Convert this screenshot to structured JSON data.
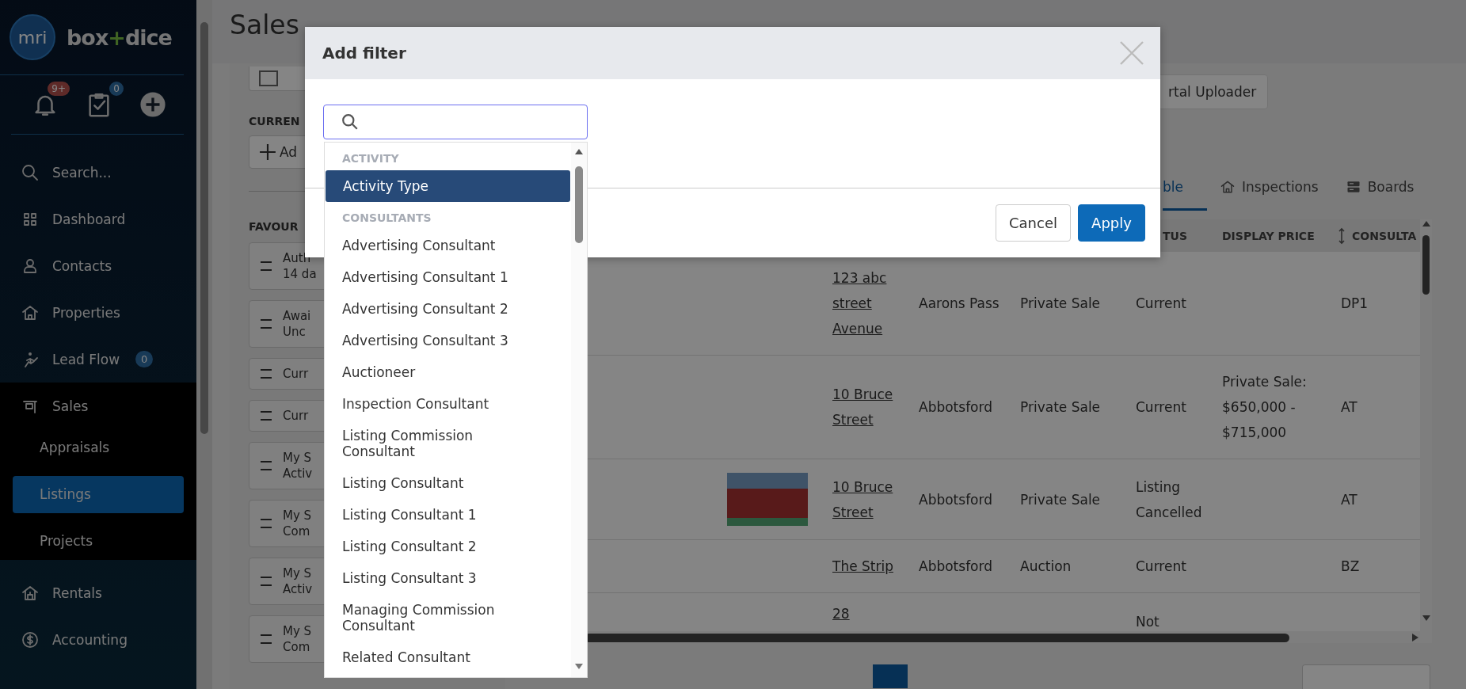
{
  "sidebar": {
    "logo_mark": "mri",
    "wordmark": [
      "box",
      "+",
      "dice"
    ],
    "quick_actions": [
      {
        "kind": "notifications",
        "badge": "9+"
      },
      {
        "kind": "tasks",
        "badge": "0"
      },
      {
        "kind": "create"
      }
    ],
    "nav": [
      {
        "label": "Search..."
      },
      {
        "label": "Dashboard"
      },
      {
        "label": "Contacts"
      },
      {
        "label": "Properties"
      },
      {
        "label": "Lead Flow",
        "badge": "0"
      },
      {
        "label": "Sales",
        "expanded": true,
        "children": [
          {
            "label": "Appraisals",
            "selected": false
          },
          {
            "label": "Listings",
            "selected": true
          },
          {
            "label": "Projects",
            "selected": false
          }
        ]
      },
      {
        "label": "Rentals"
      },
      {
        "label": "Accounting"
      }
    ]
  },
  "page": {
    "title": "Sales"
  },
  "left_panel": {
    "current_label": "CURREN",
    "add_button": "Ad",
    "favourites_label": "FAVOUR",
    "favourites": [
      {
        "lines": [
          "Auth",
          "14 da"
        ]
      },
      {
        "lines": [
          "Awai",
          "Unc"
        ]
      },
      {
        "lines": [
          "Curr"
        ]
      },
      {
        "lines": [
          "Curr"
        ]
      },
      {
        "lines": [
          "My S",
          "Activ"
        ]
      },
      {
        "lines": [
          "My S",
          "Com"
        ]
      },
      {
        "lines": [
          "My S",
          "Activ"
        ]
      },
      {
        "lines": [
          "My S",
          "Com"
        ]
      }
    ]
  },
  "toolbar": {
    "uploader_button": "rtal Uploader"
  },
  "view_tabs": [
    {
      "label": "ble",
      "selected": true
    },
    {
      "label": "Inspections",
      "selected": false
    },
    {
      "label": "Boards",
      "selected": false
    }
  ],
  "table": {
    "columns": [
      null,
      null,
      null,
      {
        "label": "TUS"
      },
      {
        "label": "DISPLAY PRICE"
      },
      {
        "label": "CONSULTA",
        "sortable": true
      }
    ],
    "rows": [
      {
        "photo": false,
        "cells": [
          "123 abc street Avenue",
          "Aarons Pass",
          "Private Sale",
          "Current",
          null,
          "DP1"
        ]
      },
      {
        "photo": false,
        "cells": [
          "10 Bruce Street",
          "Abbotsford",
          "Private Sale",
          "Current",
          "Private Sale: $650,000 - $715,000",
          "AT"
        ]
      },
      {
        "photo": true,
        "cells": [
          "10 Bruce Street",
          "Abbotsford",
          "Private Sale",
          "Listing Cancelled",
          null,
          "AT"
        ]
      },
      {
        "photo": false,
        "cells": [
          "The Strip",
          "Abbotsford",
          "Auction",
          "Current",
          null,
          "BZ"
        ]
      },
      {
        "photo": false,
        "cells": [
          "28",
          null,
          null,
          "Not",
          null,
          null
        ]
      }
    ]
  },
  "modal": {
    "title": "Add filter",
    "buttons": [
      {
        "kind": "secondary",
        "label": "Cancel"
      },
      {
        "kind": "primary",
        "label": "Apply"
      }
    ],
    "filter_groups": [
      {
        "label": "ACTIVITY",
        "options": [
          {
            "label": "Activity Type",
            "selected": true
          }
        ]
      },
      {
        "label": "CONSULTANTS",
        "options": [
          {
            "label": "Advertising Consultant",
            "selected": false
          },
          {
            "label": "Advertising Consultant 1",
            "selected": false
          },
          {
            "label": "Advertising Consultant 2",
            "selected": false
          },
          {
            "label": "Advertising Consultant 3",
            "selected": false
          },
          {
            "label": "Auctioneer",
            "selected": false
          },
          {
            "label": "Inspection Consultant",
            "selected": false
          },
          {
            "label": "Listing Commission Consultant",
            "selected": false
          },
          {
            "label": "Listing Consultant",
            "selected": false
          },
          {
            "label": "Listing Consultant 1",
            "selected": false
          },
          {
            "label": "Listing Consultant 2",
            "selected": false
          },
          {
            "label": "Listing Consultant 3",
            "selected": false
          },
          {
            "label": "Managing Commission Consultant",
            "selected": false
          },
          {
            "label": "Related Consultant",
            "selected": false
          }
        ]
      }
    ]
  }
}
